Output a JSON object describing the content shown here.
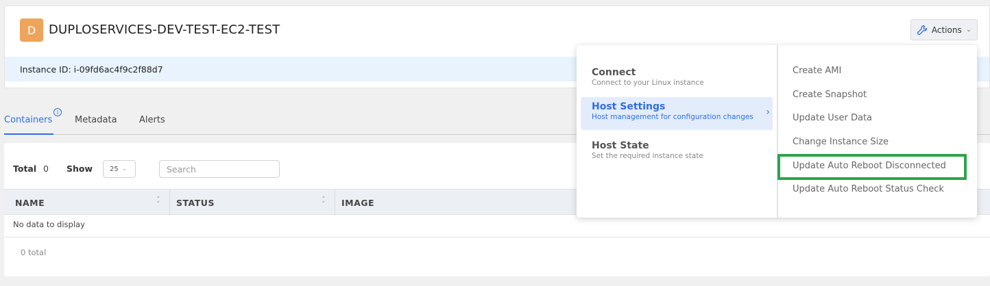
{
  "header": {
    "avatar_letter": "D",
    "title": "DUPLOSERVICES-DEV-TEST-EC2-TEST",
    "actions_label": "Actions",
    "instance_id": "Instance ID: i-09fd6ac4f9c2f88d7"
  },
  "tabs": [
    {
      "label": "Containers",
      "active": true
    },
    {
      "label": "Metadata",
      "active": false
    },
    {
      "label": "Alerts",
      "active": false
    }
  ],
  "table": {
    "total_label": "Total",
    "total_value": "0",
    "show_label": "Show",
    "page_size": "25",
    "search_placeholder": "Search",
    "columns": [
      "NAME",
      "STATUS",
      "IMAGE"
    ],
    "empty_text": "No data to display",
    "footer_total": "0 total"
  },
  "actions_menu": {
    "items": [
      {
        "title": "Connect",
        "subtitle": "Connect to your Linux instance",
        "selected": false
      },
      {
        "title": "Host Settings",
        "subtitle": "Host management for configuration changes",
        "selected": true
      },
      {
        "title": "Host State",
        "subtitle": "Set the required instance state",
        "selected": false
      }
    ],
    "submenu": [
      "Create AMI",
      "Create Snapshot",
      "Update User Data",
      "Change Instance Size",
      "Update Auto Reboot Disconnected",
      "Update Auto Reboot Status Check"
    ],
    "highlighted_item": "Update Auto Reboot Disconnected"
  },
  "colors": {
    "accent": "#2f6fde",
    "avatar": "#eea45a",
    "highlight": "#2ca44d",
    "instance_bar": "#e8f3fd"
  }
}
